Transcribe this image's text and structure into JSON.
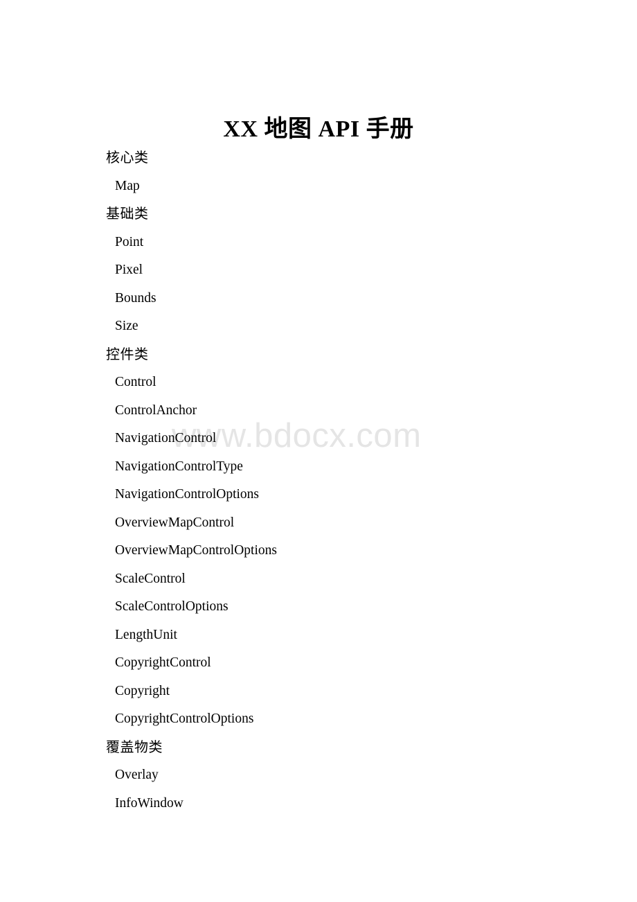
{
  "document": {
    "title": "XX 地图 API 手册",
    "watermark": "www.bdocx.com",
    "watermark_color": "#e5e5e5",
    "text_color": "#000000",
    "background_color": "#ffffff"
  },
  "toc": {
    "entries": [
      {
        "label": "核心类",
        "level": 1
      },
      {
        "label": "Map",
        "level": 2
      },
      {
        "label": "基础类",
        "level": 1
      },
      {
        "label": "Point",
        "level": 2
      },
      {
        "label": "Pixel",
        "level": 2
      },
      {
        "label": "Bounds",
        "level": 2
      },
      {
        "label": "Size",
        "level": 2
      },
      {
        "label": "控件类",
        "level": 1
      },
      {
        "label": "Control",
        "level": 2
      },
      {
        "label": "ControlAnchor",
        "level": 2
      },
      {
        "label": "NavigationControl",
        "level": 2
      },
      {
        "label": "NavigationControlType",
        "level": 2
      },
      {
        "label": "NavigationControlOptions",
        "level": 2
      },
      {
        "label": "OverviewMapControl",
        "level": 2
      },
      {
        "label": "OverviewMapControlOptions",
        "level": 2
      },
      {
        "label": "ScaleControl",
        "level": 2
      },
      {
        "label": "ScaleControlOptions",
        "level": 2
      },
      {
        "label": "LengthUnit",
        "level": 2
      },
      {
        "label": "CopyrightControl",
        "level": 2
      },
      {
        "label": "Copyright",
        "level": 2
      },
      {
        "label": "CopyrightControlOptions",
        "level": 2
      },
      {
        "label": "覆盖物类",
        "level": 1
      },
      {
        "label": "Overlay",
        "level": 2
      },
      {
        "label": "InfoWindow",
        "level": 2
      }
    ]
  }
}
